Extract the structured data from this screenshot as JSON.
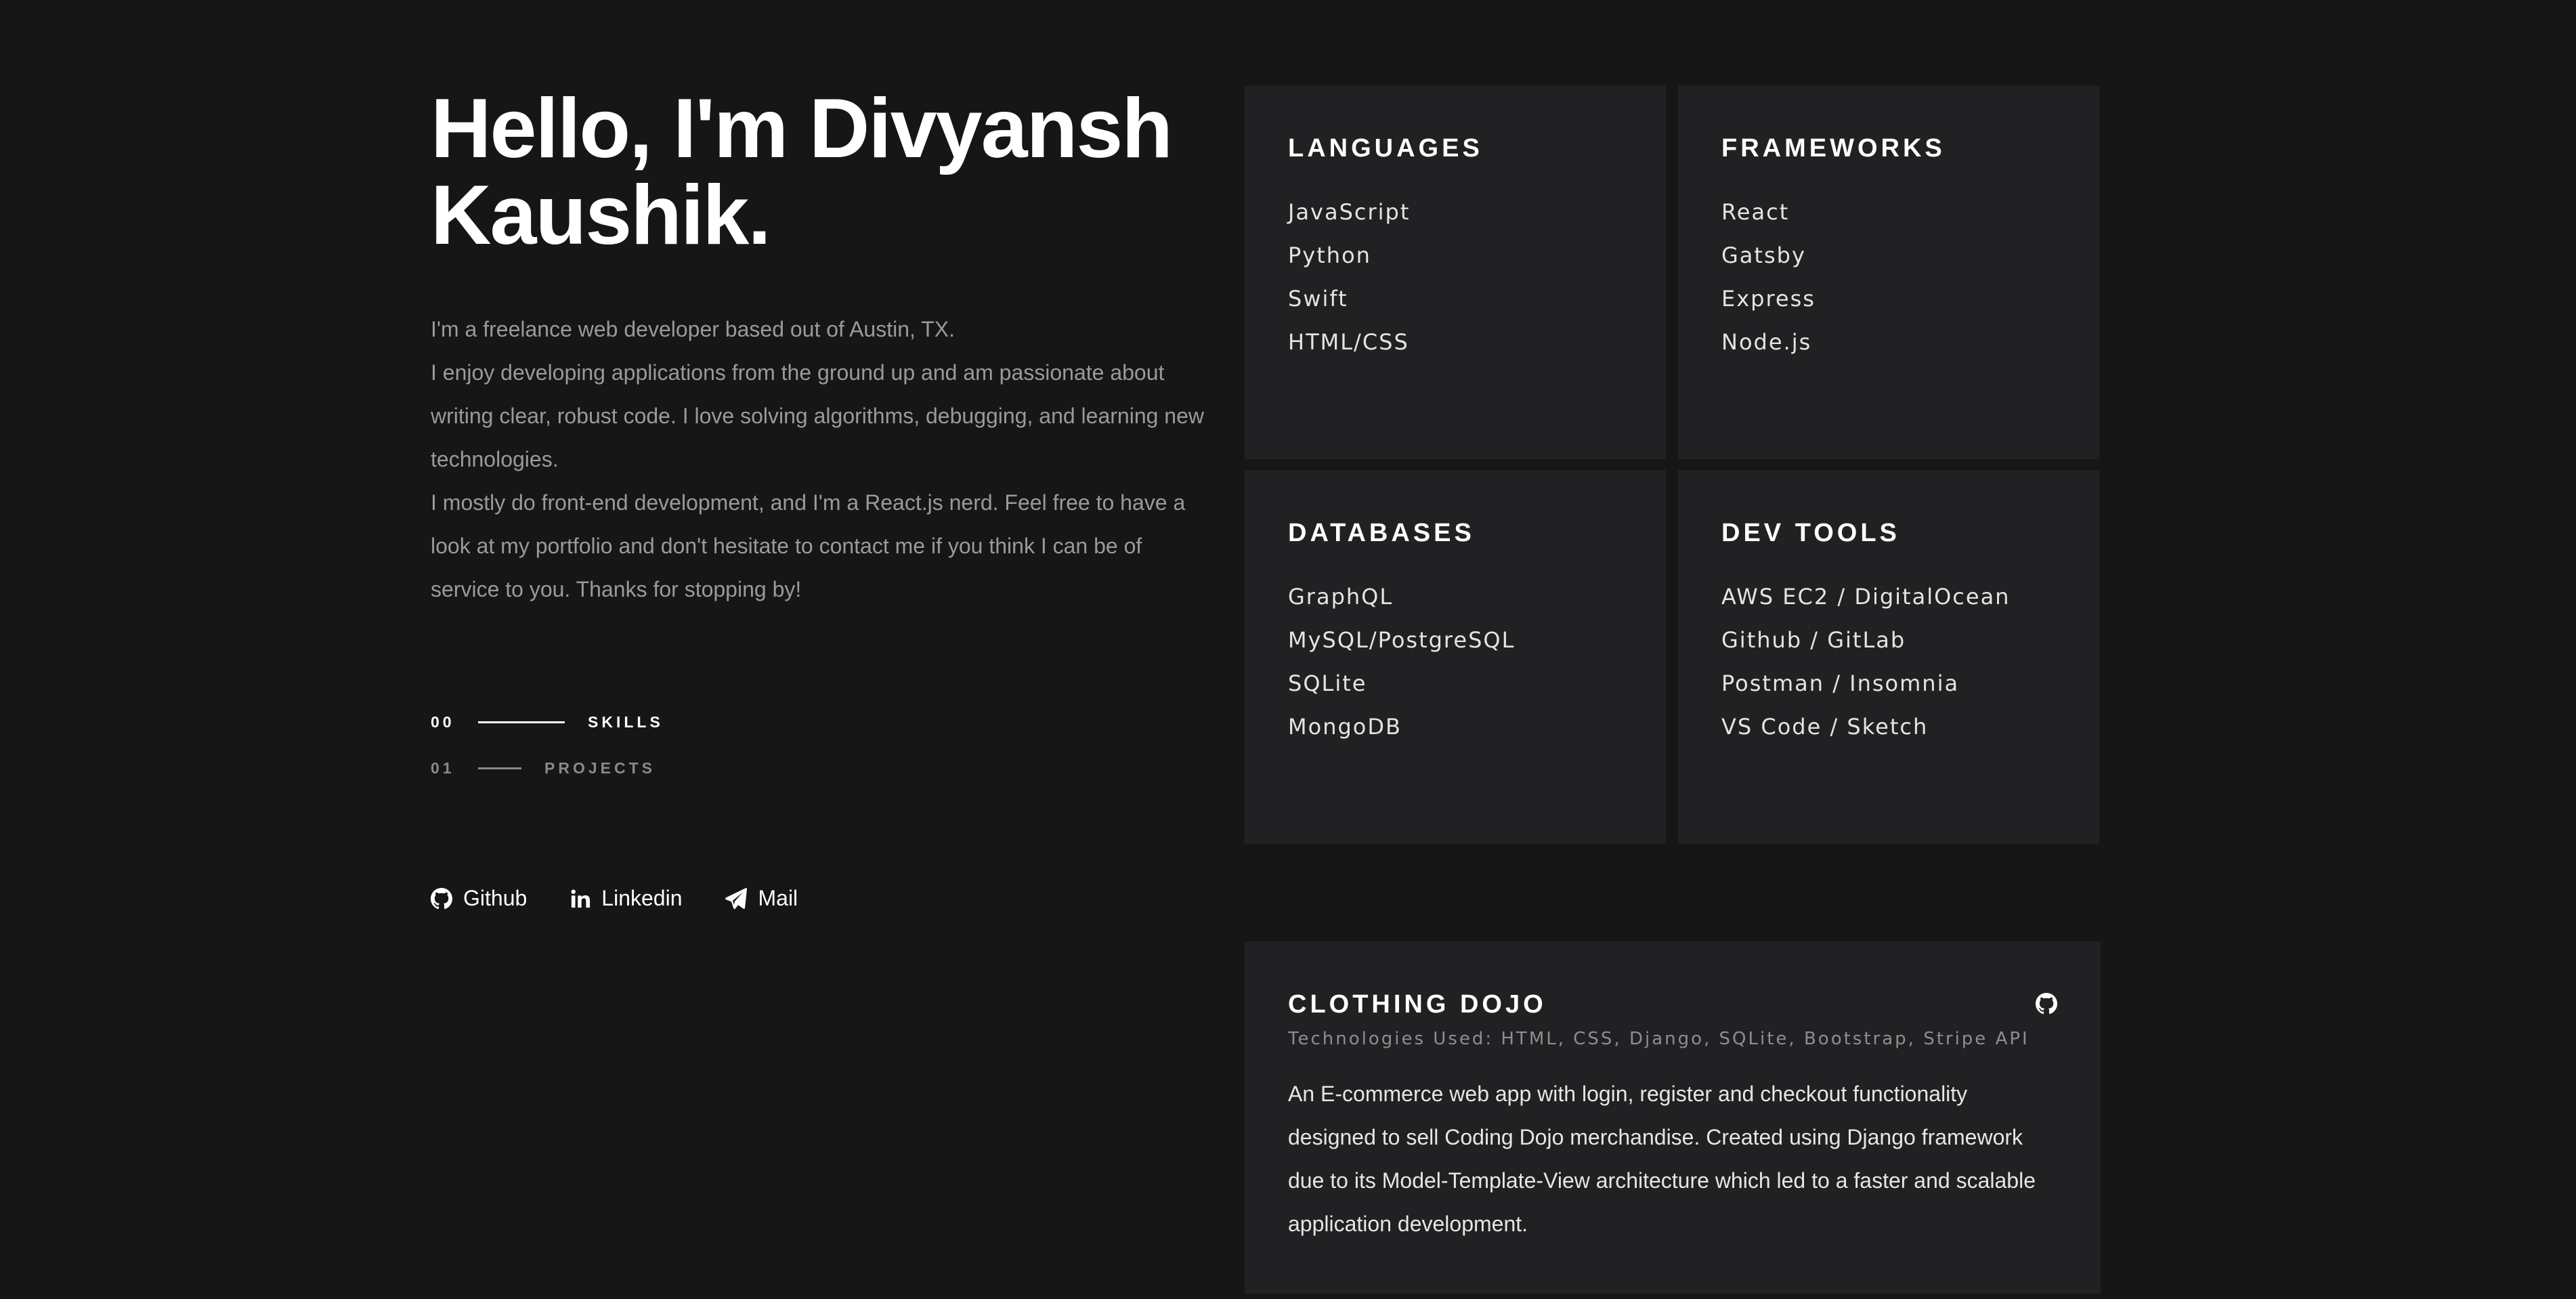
{
  "hero": {
    "title_line1": "Hello, I'm Divyansh",
    "title_line2": "Kaushik."
  },
  "bio": {
    "p1": "I'm a freelance web developer based out of Austin, TX.",
    "p2": "I enjoy developing applications from the ground up and am passionate about writing clear, robust code. I love solving algorithms, debugging, and learning new technologies.",
    "p3": "I mostly do front-end development, and I'm a React.js nerd. Feel free to have a look at my portfolio and don't hesitate to contact me if you think I can be of service to you. Thanks for stopping by!"
  },
  "nav": [
    {
      "num": "00",
      "label": "SKILLS",
      "active": true
    },
    {
      "num": "01",
      "label": "PROJECTS",
      "active": false
    }
  ],
  "social": [
    {
      "label": "Github",
      "icon": "github-icon"
    },
    {
      "label": "Linkedin",
      "icon": "linkedin-icon"
    },
    {
      "label": "Mail",
      "icon": "paper-plane-icon"
    }
  ],
  "skills": {
    "languages": {
      "title": "LANGUAGES",
      "items": [
        "JavaScript",
        "Python",
        "Swift",
        "HTML/CSS"
      ]
    },
    "frameworks": {
      "title": "FRAMEWORKS",
      "items": [
        "React",
        "Gatsby",
        "Express",
        "Node.js"
      ]
    },
    "databases": {
      "title": "DATABASES",
      "items": [
        "GraphQL",
        "MySQL/PostgreSQL",
        "SQLite",
        "MongoDB"
      ]
    },
    "devtools": {
      "title": "DEV TOOLS",
      "items": [
        "AWS EC2 / DigitalOcean",
        "Github / GitLab",
        "Postman / Insomnia",
        "VS Code / Sketch"
      ]
    }
  },
  "project": {
    "title": "CLOTHING DOJO",
    "tech": "Technologies Used: HTML, CSS, Django, SQLite, Bootstrap, Stripe API",
    "description": "An E-commerce web app with login, register and checkout functionality designed to sell Coding Dojo merchandise. Created using Django framework due to its Model-Template-View architecture which led to a faster and scalable application development.",
    "icon": "github-icon"
  },
  "colors": {
    "background": "#161617",
    "card": "#212124",
    "text_primary": "#ffffff",
    "text_muted": "#9a9a9c"
  }
}
